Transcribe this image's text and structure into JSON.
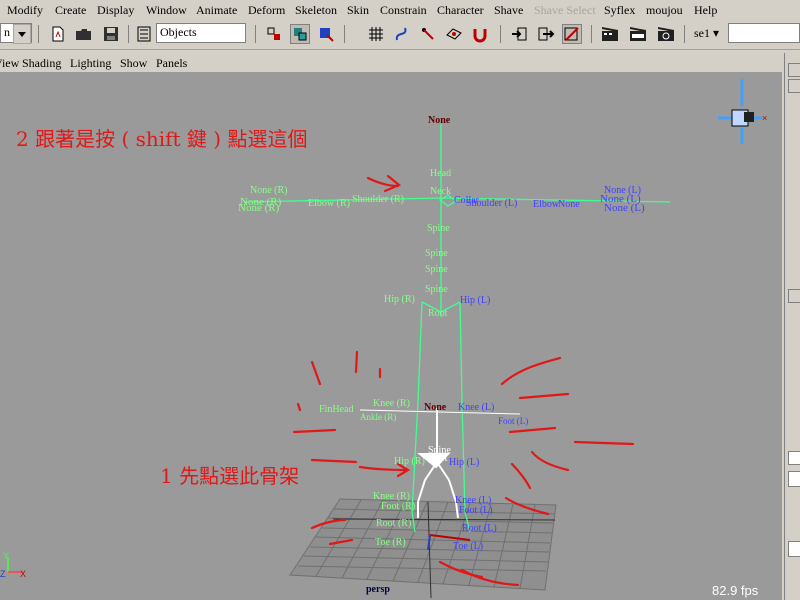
{
  "menubar": {
    "items": [
      "Modify",
      "Create",
      "Display",
      "Window",
      "Animate",
      "Deform",
      "Skeleton",
      "Skin",
      "Constrain",
      "Character",
      "Shave",
      "Shave Select",
      "Syflex",
      "moujou",
      "Help"
    ],
    "disabled_item": "Shave Select"
  },
  "toolbar": {
    "mode_value": "n",
    "selection_mask_value": "Objects",
    "field_value": "se1",
    "icons": [
      "dropdown-arrow",
      "new-scene-icon",
      "open-scene-icon",
      "save-scene-icon",
      "selection-mode-icon",
      "select-by-hierarchy-icon",
      "select-by-object-icon",
      "select-by-component-icon",
      "snap-grid-icon",
      "snap-curve-icon",
      "snap-point-icon",
      "snap-view-plane-icon",
      "make-live-icon",
      "history-input-icon",
      "history-output-icon",
      "construction-history-icon",
      "render-icon",
      "ipr-render-icon",
      "render-globals-icon"
    ]
  },
  "panel_menu": {
    "items": [
      "View",
      "Shading",
      "Lighting",
      "Show",
      "Panels"
    ]
  },
  "viewport": {
    "camera_label": "persp",
    "fps_label": "82.9 fps",
    "axis_labels": {
      "y": "Y",
      "z": "Z",
      "x": "X"
    },
    "annotations": [
      {
        "text": "2 跟著是按 ( shift 鍵 ) 點選這個"
      },
      {
        "text": "1 先點選此骨架"
      }
    ],
    "big_skeleton_labels": {
      "none": "None",
      "head": "Head",
      "neck": "Neck",
      "spine1": "Spine",
      "spine2": "Spine",
      "spine3": "Spine",
      "spine4": "Spine",
      "hip_r": "Hip (R)",
      "hip_l": "Hip (L)",
      "root": "Root",
      "shoulder_r": "Shoulder (R)",
      "elbow_r": "Elbow (R)",
      "hand_r": "None (R)",
      "collar": "Collar",
      "shoulder_l": "Shoulder (L)",
      "elbow_l": "Elbow",
      "none_l": "None",
      "hand_l": "None (L)"
    },
    "small_skeleton_labels": {
      "none": "None",
      "finhead": "FinHead",
      "knee_r_top": "Knee (R)",
      "knee_l_top": "Knee (L)",
      "ankle_r": "Ankle (R)",
      "hip_r": "Hip (R)",
      "spine": "Spine",
      "root": "Root",
      "hip_l": "Hip (L)",
      "knee_r": "Knee (R)",
      "knee_l": "Knee (L)",
      "foot_r": "Foot (R)",
      "foot_l": "Foot (L)",
      "root_r": "Root (R)",
      "root_l": "Root (L)",
      "toe_r": "Toe (R)",
      "toe_l": "Toe (L)"
    }
  },
  "colors": {
    "viewport_bg": "#9a9a9a",
    "ui_bg": "#d4d0c8",
    "bone_green": "#40ff90",
    "label_green": "#88ff88",
    "label_blue": "#4040ff",
    "label_dark_red": "#600000",
    "annotation_red": "#e01818",
    "grid": "#707070"
  }
}
